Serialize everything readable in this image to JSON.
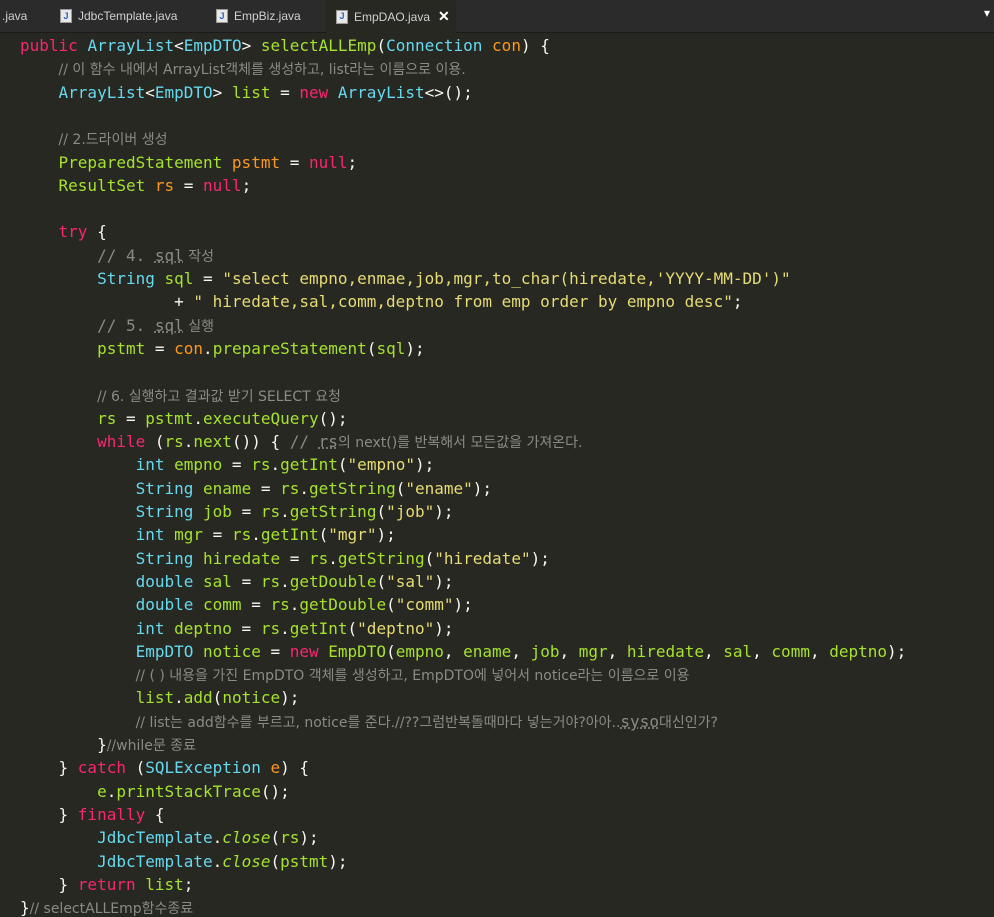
{
  "tabs": [
    {
      "label": ".java",
      "active": false
    },
    {
      "label": "JdbcTemplate.java",
      "active": false
    },
    {
      "label": "EmpBiz.java",
      "active": false
    },
    {
      "label": "EmpDAO.java",
      "active": true
    }
  ],
  "close_glyph": "✕",
  "menu_glyph": "▾",
  "code": [
    [
      [
        "k",
        "public "
      ],
      [
        "t",
        "ArrayList"
      ],
      [
        "n",
        "<"
      ],
      [
        "t",
        "EmpDTO"
      ],
      [
        "n",
        "> "
      ],
      [
        "f",
        "selectALLEmp"
      ],
      [
        "n",
        "("
      ],
      [
        "t",
        "Connection "
      ],
      [
        "v",
        "con"
      ],
      [
        "n",
        ") {"
      ]
    ],
    [
      [
        "n",
        "    "
      ],
      [
        "c",
        "// 이 함수 내에서 ArrayList객체를 생성하고, list라는 이름으로 이용."
      ]
    ],
    [
      [
        "n",
        "    "
      ],
      [
        "t",
        "ArrayList"
      ],
      [
        "n",
        "<"
      ],
      [
        "t",
        "EmpDTO"
      ],
      [
        "n",
        "> "
      ],
      [
        "f",
        "list"
      ],
      [
        "n",
        " = "
      ],
      [
        "k",
        "new "
      ],
      [
        "t",
        "ArrayList"
      ],
      [
        "n",
        "<>();"
      ]
    ],
    [],
    [
      [
        "n",
        "    "
      ],
      [
        "c",
        "// 2.드라이버 생성"
      ]
    ],
    [
      [
        "n",
        "    "
      ],
      [
        "f",
        "PreparedStatement "
      ],
      [
        "v",
        "pstmt"
      ],
      [
        "n",
        " = "
      ],
      [
        "k",
        "null"
      ],
      [
        "n",
        ";"
      ]
    ],
    [
      [
        "n",
        "    "
      ],
      [
        "f",
        "ResultSet "
      ],
      [
        "v",
        "rs"
      ],
      [
        "n",
        " = "
      ],
      [
        "k",
        "null"
      ],
      [
        "n",
        ";"
      ]
    ],
    [],
    [
      [
        "n",
        "    "
      ],
      [
        "k",
        "try"
      ],
      [
        "n",
        " {"
      ]
    ],
    [
      [
        "n",
        "        "
      ],
      [
        "c",
        "// 4. "
      ],
      [
        "cu",
        "sql"
      ],
      [
        "c",
        " 작성"
      ]
    ],
    [
      [
        "n",
        "        "
      ],
      [
        "t",
        "String "
      ],
      [
        "f",
        "sql"
      ],
      [
        "n",
        " = "
      ],
      [
        "s",
        "\"select empno,enmae,job,mgr,to_char(hiredate,'YYYY-MM-DD')\""
      ]
    ],
    [
      [
        "n",
        "                "
      ],
      [
        "n",
        "+ "
      ],
      [
        "s",
        "\" hiredate,sal,comm,deptno from emp order by empno desc\""
      ],
      [
        "n",
        ";"
      ]
    ],
    [
      [
        "n",
        "        "
      ],
      [
        "c",
        "// 5. "
      ],
      [
        "cu",
        "sql"
      ],
      [
        "c",
        " 실행"
      ]
    ],
    [
      [
        "n",
        "        "
      ],
      [
        "f",
        "pstmt"
      ],
      [
        "n",
        " = "
      ],
      [
        "v",
        "con"
      ],
      [
        "n",
        "."
      ],
      [
        "f",
        "prepareStatement"
      ],
      [
        "n",
        "("
      ],
      [
        "f",
        "sql"
      ],
      [
        "n",
        ");"
      ]
    ],
    [],
    [
      [
        "n",
        "        "
      ],
      [
        "c",
        "// 6. 실행하고 결과값 받기 SELECT 요청"
      ]
    ],
    [
      [
        "n",
        "        "
      ],
      [
        "f",
        "rs"
      ],
      [
        "n",
        " = "
      ],
      [
        "f",
        "pstmt"
      ],
      [
        "n",
        "."
      ],
      [
        "f",
        "executeQuery"
      ],
      [
        "n",
        "();"
      ]
    ],
    [
      [
        "n",
        "        "
      ],
      [
        "k",
        "while "
      ],
      [
        "n",
        "("
      ],
      [
        "f",
        "rs"
      ],
      [
        "n",
        "."
      ],
      [
        "f",
        "next"
      ],
      [
        "n",
        "()) { "
      ],
      [
        "c",
        "// "
      ],
      [
        "cu",
        "rs"
      ],
      [
        "c",
        "의 next()를 반복해서 모든값을 가져온다."
      ]
    ],
    [
      [
        "n",
        "            "
      ],
      [
        "t",
        "int "
      ],
      [
        "f",
        "empno"
      ],
      [
        "n",
        " = "
      ],
      [
        "f",
        "rs"
      ],
      [
        "n",
        "."
      ],
      [
        "f",
        "getInt"
      ],
      [
        "n",
        "("
      ],
      [
        "s",
        "\"empno\""
      ],
      [
        "n",
        ");"
      ]
    ],
    [
      [
        "n",
        "            "
      ],
      [
        "t",
        "String "
      ],
      [
        "f",
        "ename"
      ],
      [
        "n",
        " = "
      ],
      [
        "f",
        "rs"
      ],
      [
        "n",
        "."
      ],
      [
        "f",
        "getString"
      ],
      [
        "n",
        "("
      ],
      [
        "s",
        "\"ename\""
      ],
      [
        "n",
        ");"
      ]
    ],
    [
      [
        "n",
        "            "
      ],
      [
        "t",
        "String "
      ],
      [
        "f",
        "job"
      ],
      [
        "n",
        " = "
      ],
      [
        "f",
        "rs"
      ],
      [
        "n",
        "."
      ],
      [
        "f",
        "getString"
      ],
      [
        "n",
        "("
      ],
      [
        "s",
        "\"job\""
      ],
      [
        "n",
        ");"
      ]
    ],
    [
      [
        "n",
        "            "
      ],
      [
        "t",
        "int "
      ],
      [
        "f",
        "mgr"
      ],
      [
        "n",
        " = "
      ],
      [
        "f",
        "rs"
      ],
      [
        "n",
        "."
      ],
      [
        "f",
        "getInt"
      ],
      [
        "n",
        "("
      ],
      [
        "s",
        "\"mgr\""
      ],
      [
        "n",
        ");"
      ]
    ],
    [
      [
        "n",
        "            "
      ],
      [
        "t",
        "String "
      ],
      [
        "f",
        "hiredate"
      ],
      [
        "n",
        " = "
      ],
      [
        "f",
        "rs"
      ],
      [
        "n",
        "."
      ],
      [
        "f",
        "getString"
      ],
      [
        "n",
        "("
      ],
      [
        "s",
        "\"hiredate\""
      ],
      [
        "n",
        ");"
      ]
    ],
    [
      [
        "n",
        "            "
      ],
      [
        "t",
        "double "
      ],
      [
        "f",
        "sal"
      ],
      [
        "n",
        " = "
      ],
      [
        "f",
        "rs"
      ],
      [
        "n",
        "."
      ],
      [
        "f",
        "getDouble"
      ],
      [
        "n",
        "("
      ],
      [
        "s",
        "\"sal\""
      ],
      [
        "n",
        ");"
      ]
    ],
    [
      [
        "n",
        "            "
      ],
      [
        "t",
        "double "
      ],
      [
        "f",
        "comm"
      ],
      [
        "n",
        " = "
      ],
      [
        "f",
        "rs"
      ],
      [
        "n",
        "."
      ],
      [
        "f",
        "getDouble"
      ],
      [
        "n",
        "("
      ],
      [
        "s",
        "\"comm\""
      ],
      [
        "n",
        ");"
      ]
    ],
    [
      [
        "n",
        "            "
      ],
      [
        "t",
        "int "
      ],
      [
        "f",
        "deptno"
      ],
      [
        "n",
        " = "
      ],
      [
        "f",
        "rs"
      ],
      [
        "n",
        "."
      ],
      [
        "f",
        "getInt"
      ],
      [
        "n",
        "("
      ],
      [
        "s",
        "\"deptno\""
      ],
      [
        "n",
        ");"
      ]
    ],
    [
      [
        "n",
        "            "
      ],
      [
        "t",
        "EmpDTO "
      ],
      [
        "f",
        "notice"
      ],
      [
        "n",
        " = "
      ],
      [
        "k",
        "new "
      ],
      [
        "f",
        "EmpDTO"
      ],
      [
        "n",
        "("
      ],
      [
        "f",
        "empno"
      ],
      [
        "n",
        ", "
      ],
      [
        "f",
        "ename"
      ],
      [
        "n",
        ", "
      ],
      [
        "f",
        "job"
      ],
      [
        "n",
        ", "
      ],
      [
        "f",
        "mgr"
      ],
      [
        "n",
        ", "
      ],
      [
        "f",
        "hiredate"
      ],
      [
        "n",
        ", "
      ],
      [
        "f",
        "sal"
      ],
      [
        "n",
        ", "
      ],
      [
        "f",
        "comm"
      ],
      [
        "n",
        ", "
      ],
      [
        "f",
        "deptno"
      ],
      [
        "n",
        ");"
      ]
    ],
    [
      [
        "n",
        "            "
      ],
      [
        "c",
        "// ( ) 내용을 가진 EmpDTO 객체를 생성하고, EmpDTO에 넣어서 notice라는 이름으로 이용"
      ]
    ],
    [
      [
        "n",
        "            "
      ],
      [
        "f",
        "list"
      ],
      [
        "n",
        "."
      ],
      [
        "f",
        "add"
      ],
      [
        "n",
        "("
      ],
      [
        "f",
        "notice"
      ],
      [
        "n",
        ");"
      ]
    ],
    [
      [
        "n",
        "            "
      ],
      [
        "c",
        "// list는 add함수를 부르고, notice를 준다.//??그럼반복돌때마다 넣는거야?아아.."
      ],
      [
        "cu",
        "syso"
      ],
      [
        "c",
        "대신인가?"
      ]
    ],
    [
      [
        "n",
        "        "
      ],
      [
        "n",
        "}"
      ],
      [
        "c",
        "//while문 종료"
      ]
    ],
    [
      [
        "n",
        "    "
      ],
      [
        "n",
        "} "
      ],
      [
        "k",
        "catch "
      ],
      [
        "n",
        "("
      ],
      [
        "t",
        "SQLException "
      ],
      [
        "v",
        "e"
      ],
      [
        "n",
        ") {"
      ]
    ],
    [
      [
        "n",
        "        "
      ],
      [
        "f",
        "e"
      ],
      [
        "n",
        "."
      ],
      [
        "f",
        "printStackTrace"
      ],
      [
        "n",
        "();"
      ]
    ],
    [
      [
        "n",
        "    "
      ],
      [
        "n",
        "} "
      ],
      [
        "k",
        "finally "
      ],
      [
        "n",
        "{"
      ]
    ],
    [
      [
        "n",
        "        "
      ],
      [
        "t",
        "JdbcTemplate"
      ],
      [
        "n",
        "."
      ],
      [
        "m",
        "close"
      ],
      [
        "n",
        "("
      ],
      [
        "f",
        "rs"
      ],
      [
        "n",
        ");"
      ]
    ],
    [
      [
        "n",
        "        "
      ],
      [
        "t",
        "JdbcTemplate"
      ],
      [
        "n",
        "."
      ],
      [
        "m",
        "close"
      ],
      [
        "n",
        "("
      ],
      [
        "f",
        "pstmt"
      ],
      [
        "n",
        ");"
      ]
    ],
    [
      [
        "n",
        "    "
      ],
      [
        "n",
        "} "
      ],
      [
        "k",
        "return "
      ],
      [
        "f",
        "list"
      ],
      [
        "n",
        ";"
      ]
    ],
    [
      [
        "n",
        "}"
      ],
      [
        "c",
        "// selectALLEmp함수종료"
      ]
    ]
  ]
}
